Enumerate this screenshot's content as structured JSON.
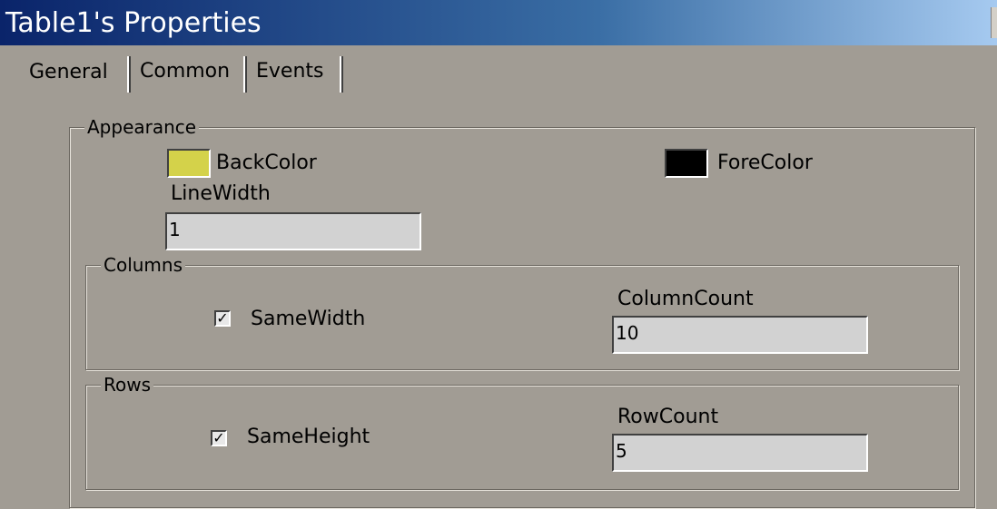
{
  "window": {
    "title": "Table1's Properties"
  },
  "tabs": [
    {
      "label": "General",
      "active": true
    },
    {
      "label": "Common",
      "active": false
    },
    {
      "label": "Events",
      "active": false
    }
  ],
  "appearance": {
    "legend": "Appearance",
    "back_color_label": "BackColor",
    "back_color": "#d4d24a",
    "fore_color_label": "ForeColor",
    "fore_color": "#000000",
    "line_width_label": "LineWidth",
    "line_width_value": "1"
  },
  "columns": {
    "legend": "Columns",
    "same_width_label": "SameWidth",
    "same_width_checked": true,
    "count_label": "ColumnCount",
    "count_value": "10"
  },
  "rows": {
    "legend": "Rows",
    "same_height_label": "SameHeight",
    "same_height_checked": true,
    "count_label": "RowCount",
    "count_value": "5"
  }
}
